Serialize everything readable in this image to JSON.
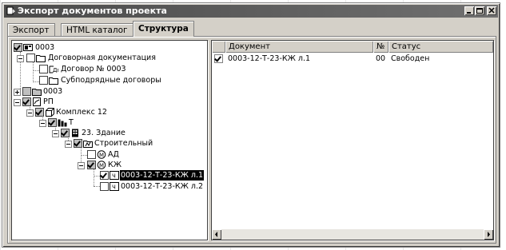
{
  "window": {
    "title": "Экспорт документов проекта"
  },
  "tabs": [
    {
      "label": "Экспорт"
    },
    {
      "label": "HTML каталог"
    },
    {
      "label": "Структура"
    }
  ],
  "tree": {
    "nodes": [
      {
        "label": "0003"
      },
      {
        "label": "Договорная документация"
      },
      {
        "label": "Договор № 0003"
      },
      {
        "label": "Субподрядные договоры"
      },
      {
        "label": "0003"
      },
      {
        "label": "РП"
      },
      {
        "label": "Комплекс 12"
      },
      {
        "label": "Т"
      },
      {
        "label": "23. Здание"
      },
      {
        "label": "Строительный"
      },
      {
        "label": "АД"
      },
      {
        "label": "КЖ"
      },
      {
        "label": "0003-12-Т-23-КЖ л.1"
      },
      {
        "label": "0003-12-Т-23-КЖ л.2"
      }
    ]
  },
  "list": {
    "columns": {
      "document": "Документ",
      "number": "№",
      "status": "Статус"
    },
    "rows": [
      {
        "document": "0003-12-Т-23-КЖ л.1",
        "number": "00",
        "status": "Свободен",
        "checked": true
      }
    ]
  }
}
